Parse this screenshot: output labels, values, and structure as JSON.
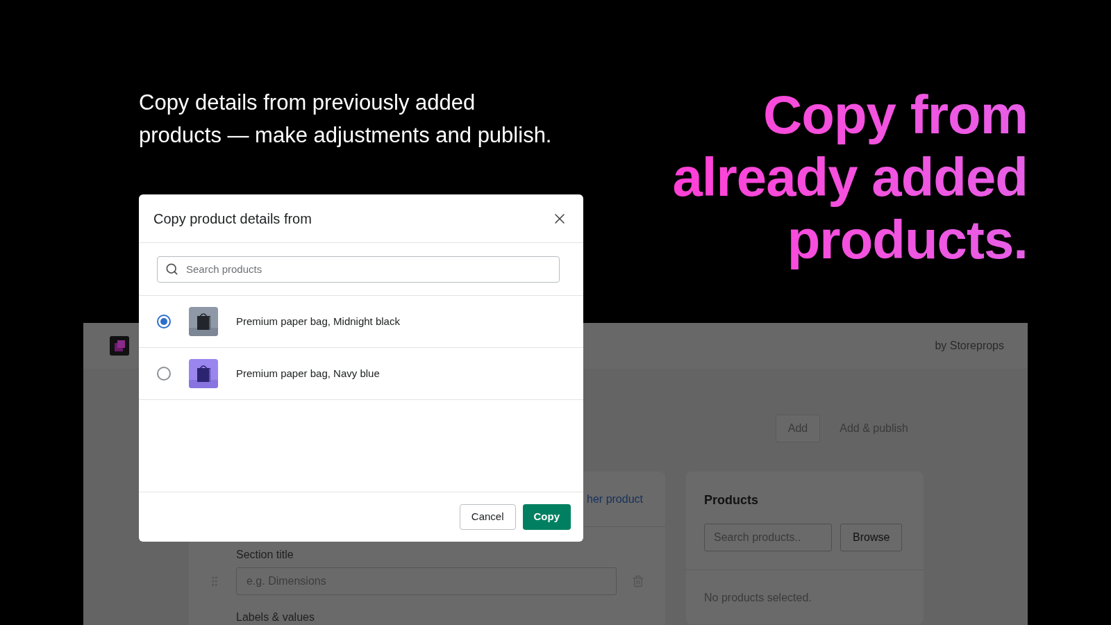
{
  "tagline": [
    "Copy details from previously added",
    "products — make adjustments and publish."
  ],
  "headline": [
    "Copy from",
    "already added",
    "products."
  ],
  "app": {
    "vendor": "by Storeprops",
    "actions": [
      {
        "label": "Add",
        "kind": "outlined"
      },
      {
        "label": "Add & publish",
        "kind": "plain"
      }
    ],
    "editor_card": {
      "link": "her product",
      "section_title_label": "Section title",
      "section_title_placeholder": "e.g. Dimensions",
      "labels_heading": "Labels & values"
    },
    "products_card": {
      "title": "Products",
      "search_placeholder": "Search products..",
      "browse": "Browse",
      "empty": "No products selected."
    }
  },
  "dialog": {
    "title": "Copy product details from",
    "search_placeholder": "Search products",
    "products": [
      {
        "name": "Premium paper bag, Midnight black",
        "selected": true
      },
      {
        "name": "Premium paper bag, Navy blue",
        "selected": false
      }
    ],
    "buttons": [
      {
        "label": "Cancel",
        "kind": "secondary"
      },
      {
        "label": "Copy",
        "kind": "primary"
      }
    ]
  }
}
